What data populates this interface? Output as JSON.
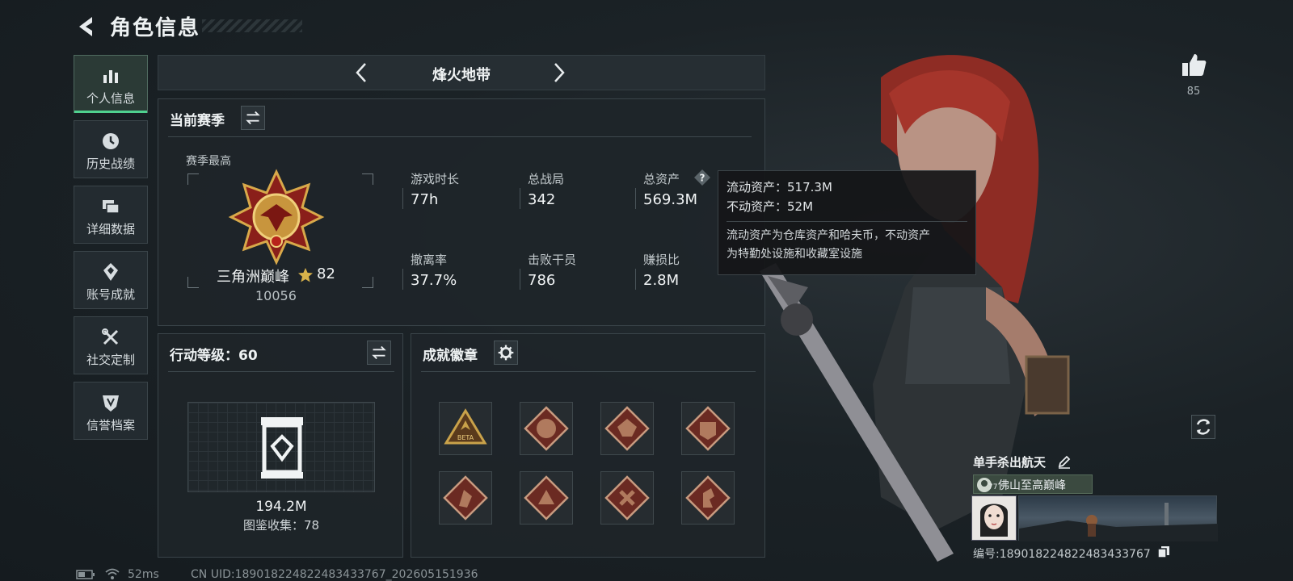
{
  "header": {
    "title": "角色信息"
  },
  "sidebar": {
    "items": [
      {
        "label": "个人信息",
        "icon": "bar-chart-icon",
        "active": true
      },
      {
        "label": "历史战绩",
        "icon": "clock-icon"
      },
      {
        "label": "详细数据",
        "icon": "folders-icon"
      },
      {
        "label": "账号成就",
        "icon": "achievement-icon"
      },
      {
        "label": "社交定制",
        "icon": "tools-icon"
      },
      {
        "label": "信誉档案",
        "icon": "shield-icon"
      }
    ]
  },
  "mode_selector": {
    "label": "烽火地带"
  },
  "season": {
    "title": "当前赛季",
    "best_label": "赛季最高",
    "rank_name": "三角洲巅峰",
    "rank_stars": "82",
    "rank_score": "10056",
    "stats": [
      {
        "label": "游戏时长",
        "value": "77h"
      },
      {
        "label": "总战局",
        "value": "342"
      },
      {
        "label": "总资产",
        "value": "569.3M"
      },
      {
        "label": "撤离率",
        "value": "37.7%"
      },
      {
        "label": "击败干员",
        "value": "786"
      },
      {
        "label": "赚损比",
        "value": "2.8M"
      }
    ]
  },
  "tooltip": {
    "liquid": "流动资产：517.3M",
    "fixed": "不动资产：52M",
    "note_line1": "流动资产为仓库资产和哈夫币，不动资产",
    "note_line2": "为特勤处设施和收藏室设施"
  },
  "action_level": {
    "title": "行动等级：60",
    "value": "194.2M",
    "collection": "图鉴收集：78"
  },
  "badges": {
    "title": "成就徽章",
    "items": [
      "BETA",
      "",
      "",
      "",
      "",
      "",
      "",
      ""
    ],
    "colors": {
      "beta_border": "#c9a24a",
      "badge_fill": "#6b2a22",
      "badge_border": "#c79a7f"
    }
  },
  "character": {
    "likes": "85",
    "name": "单手杀出航天",
    "title": "佛山至高巅峰",
    "level": "77",
    "id_label": "编号:18901822482248343376​7"
  },
  "status_bar": {
    "ping": "52ms",
    "uid": "CN UID:18901822482248343376​7_202605151936"
  },
  "colors": {
    "accent": "#4fd18f",
    "hair": "#a5352b"
  }
}
